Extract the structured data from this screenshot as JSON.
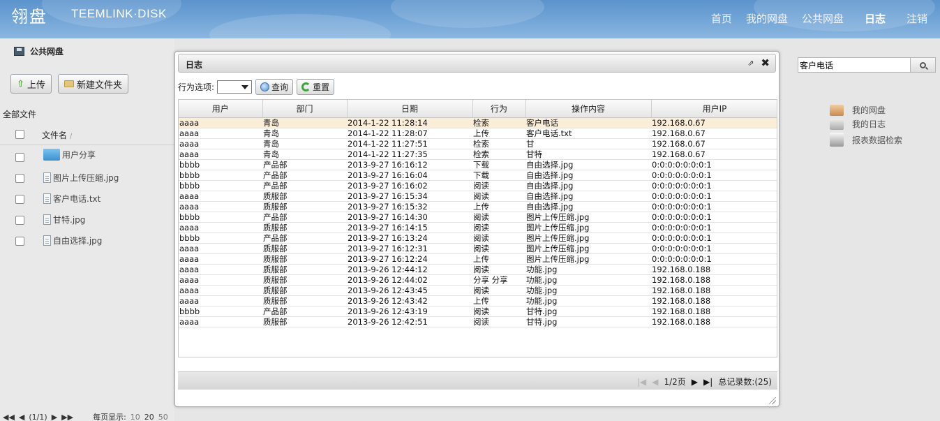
{
  "header": {
    "logo": "翎盘",
    "logo_sub": "TEEMLINK·DISK",
    "nav": [
      "首页",
      "我的网盘",
      "公共网盘",
      "日志",
      "注销"
    ],
    "active_nav": "日志"
  },
  "left": {
    "title": "公共网盘",
    "upload_label": "上传",
    "new_folder_label": "新建文件夹",
    "all_files": "全部文件",
    "filename_header": "文件名",
    "sort_mark": "/",
    "files": [
      {
        "name": "用户分享",
        "type": "folder"
      },
      {
        "name": "图片上传压缩.jpg",
        "type": "file"
      },
      {
        "name": "客户电话.txt",
        "type": "file"
      },
      {
        "name": "甘特.jpg",
        "type": "file"
      },
      {
        "name": "自由选择.jpg",
        "type": "file"
      }
    ],
    "pager": {
      "first": "◀◀",
      "prev": "◀",
      "page": "(1/1)",
      "next": "▶",
      "last": "▶▶",
      "per_page_label": "每页显示:",
      "options": [
        "10",
        "20",
        "50"
      ]
    }
  },
  "right": {
    "search_value": "客户电话",
    "items": [
      "我的网盘",
      "我的日志",
      "报表数据检索"
    ]
  },
  "dialog": {
    "title": "日志",
    "filter_label": "行为选项:",
    "query_label": "查询",
    "reset_label": "重置",
    "columns": [
      "用户",
      "部门",
      "日期",
      "行为",
      "操作内容",
      "用户IP"
    ],
    "rows": [
      [
        "aaaa",
        "青岛",
        "2014-1-22 11:28:14",
        "检索",
        "客户电话",
        "192.168.0.67"
      ],
      [
        "aaaa",
        "青岛",
        "2014-1-22 11:28:07",
        "上传",
        "客户电话.txt",
        "192.168.0.67"
      ],
      [
        "aaaa",
        "青岛",
        "2014-1-22 11:27:51",
        "检索",
        "甘",
        "192.168.0.67"
      ],
      [
        "aaaa",
        "青岛",
        "2014-1-22 11:27:35",
        "检索",
        "甘特",
        "192.168.0.67"
      ],
      [
        "bbbb",
        "产品部",
        "2013-9-27 16:16:12",
        "下载",
        "自由选择.jpg",
        "0:0:0:0:0:0:0:1"
      ],
      [
        "bbbb",
        "产品部",
        "2013-9-27 16:16:04",
        "下载",
        "自由选择.jpg",
        "0:0:0:0:0:0:0:1"
      ],
      [
        "bbbb",
        "产品部",
        "2013-9-27 16:16:02",
        "阅读",
        "自由选择.jpg",
        "0:0:0:0:0:0:0:1"
      ],
      [
        "aaaa",
        "质服部",
        "2013-9-27 16:15:34",
        "阅读",
        "自由选择.jpg",
        "0:0:0:0:0:0:0:1"
      ],
      [
        "aaaa",
        "质服部",
        "2013-9-27 16:15:32",
        "上传",
        "自由选择.jpg",
        "0:0:0:0:0:0:0:1"
      ],
      [
        "bbbb",
        "产品部",
        "2013-9-27 16:14:30",
        "阅读",
        "图片上传压缩.jpg",
        "0:0:0:0:0:0:0:1"
      ],
      [
        "aaaa",
        "质服部",
        "2013-9-27 16:14:15",
        "阅读",
        "图片上传压缩.jpg",
        "0:0:0:0:0:0:0:1"
      ],
      [
        "bbbb",
        "产品部",
        "2013-9-27 16:13:24",
        "阅读",
        "图片上传压缩.jpg",
        "0:0:0:0:0:0:0:1"
      ],
      [
        "aaaa",
        "质服部",
        "2013-9-27 16:12:31",
        "阅读",
        "图片上传压缩.jpg",
        "0:0:0:0:0:0:0:1"
      ],
      [
        "aaaa",
        "质服部",
        "2013-9-27 16:12:24",
        "上传",
        "图片上传压缩.jpg",
        "0:0:0:0:0:0:0:1"
      ],
      [
        "aaaa",
        "质服部",
        "2013-9-26 12:44:12",
        "阅读",
        "功能.jpg",
        "192.168.0.188"
      ],
      [
        "aaaa",
        "质服部",
        "2013-9-26 12:44:02",
        "分享 分享",
        "功能.jpg",
        "192.168.0.188"
      ],
      [
        "aaaa",
        "质服部",
        "2013-9-26 12:43:45",
        "阅读",
        "功能.jpg",
        "192.168.0.188"
      ],
      [
        "aaaa",
        "质服部",
        "2013-9-26 12:43:42",
        "上传",
        "功能.jpg",
        "192.168.0.188"
      ],
      [
        "bbbb",
        "产品部",
        "2013-9-26 12:43:19",
        "阅读",
        "甘特.jpg",
        "192.168.0.188"
      ],
      [
        "aaaa",
        "质服部",
        "2013-9-26 12:42:51",
        "阅读",
        "甘特.jpg",
        "192.168.0.188"
      ]
    ],
    "pager": {
      "page": "1/2页",
      "total": "总记录数:(25)"
    }
  },
  "colors": {
    "header": "#6fa3d6",
    "highlight_row": "#fbeed9",
    "panel": "#e6e6e6"
  }
}
